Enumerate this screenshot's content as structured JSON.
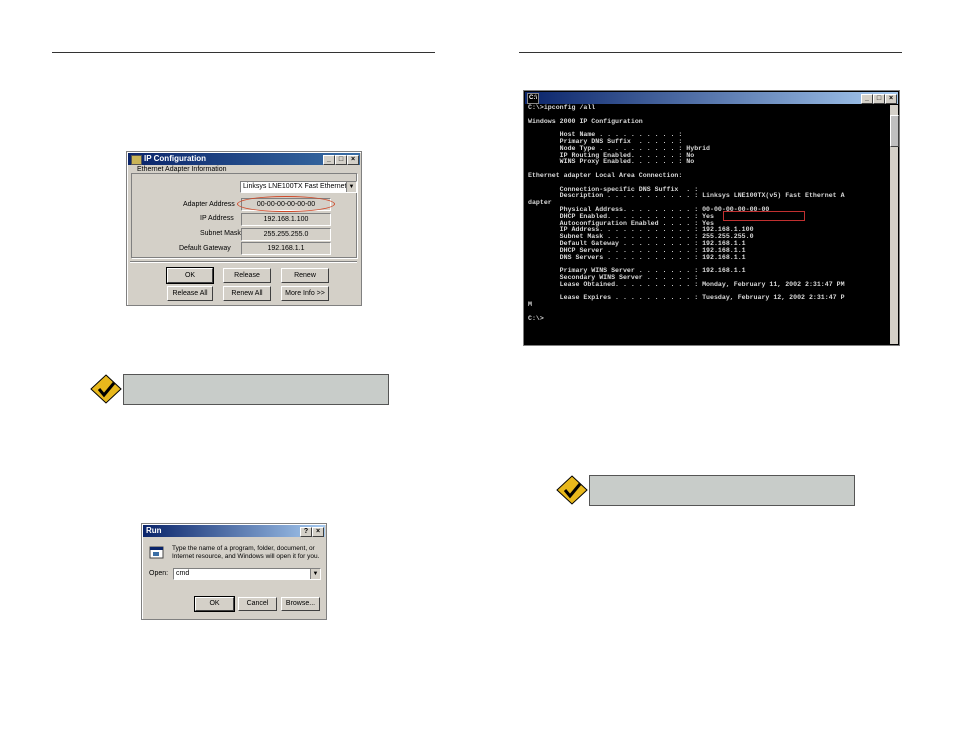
{
  "ipconfig_dialog": {
    "title": "IP Configuration",
    "group_label": "Ethernet  Adapter Information",
    "adapter_select": "Linksys LNE100TX Fast Ethernet",
    "rows": [
      {
        "label": "Adapter Address",
        "value": "00-00-00-00-00-00"
      },
      {
        "label": "IP Address",
        "value": "192.168.1.100"
      },
      {
        "label": "Subnet Mask",
        "value": "255.255.255.0"
      },
      {
        "label": "Default Gateway",
        "value": "192.168.1.1"
      }
    ],
    "buttons": {
      "ok": "OK",
      "release": "Release",
      "renew": "Renew",
      "release_all": "Release All",
      "renew_all": "Renew All",
      "more_info": "More Info >>"
    }
  },
  "run_dialog": {
    "title": "Run",
    "description": "Type the name of a program, folder, document, or Internet resource, and Windows will open it for you.",
    "open_label": "Open:",
    "open_value": "cmd",
    "buttons": {
      "ok": "OK",
      "cancel": "Cancel",
      "browse": "Browse..."
    }
  },
  "terminal": {
    "title_icon": "C:\\",
    "output": "C:\\>ipconfig /all\n\nWindows 2000 IP Configuration\n\n        Host Name . . . . . . . . . . :\n        Primary DNS Suffix  . . . . . :\n        Node Type . . . . . . . . . . : Hybrid\n        IP Routing Enabled. . . . . . : No\n        WINS Proxy Enabled. . . . . . : No\n\nEthernet adapter Local Area Connection:\n\n        Connection-specific DNS Suffix  . :\n        Description . . . . . . . . . . . : Linksys LNE100TX(v5) Fast Ethernet A\ndapter\n        Physical Address. . . . . . . . . : 00-00-00-00-00-00\n        DHCP Enabled. . . . . . . . . . . : Yes\n        Autoconfiguration Enabled . . . . : Yes\n        IP Address. . . . . . . . . . . . : 192.168.1.100\n        Subnet Mask . . . . . . . . . . . : 255.255.255.0\n        Default Gateway . . . . . . . . . : 192.168.1.1\n        DHCP Server . . . . . . . . . . . : 192.168.1.1\n        DNS Servers . . . . . . . . . . . : 192.168.1.1\n\n        Primary WINS Server . . . . . . . : 192.168.1.1\n        Secondary WINS Server . . . . . . :\n        Lease Obtained. . . . . . . . . . : Monday, February 11, 2002 2:31:47 PM\n\n        Lease Expires . . . . . . . . . . : Tuesday, February 12, 2002 2:31:47 P\nM\n\nC:\\>"
  },
  "colors": {
    "note_bg": "#c8ccc9",
    "check_badge": "#e8b81c",
    "highlight": "#c03030"
  }
}
